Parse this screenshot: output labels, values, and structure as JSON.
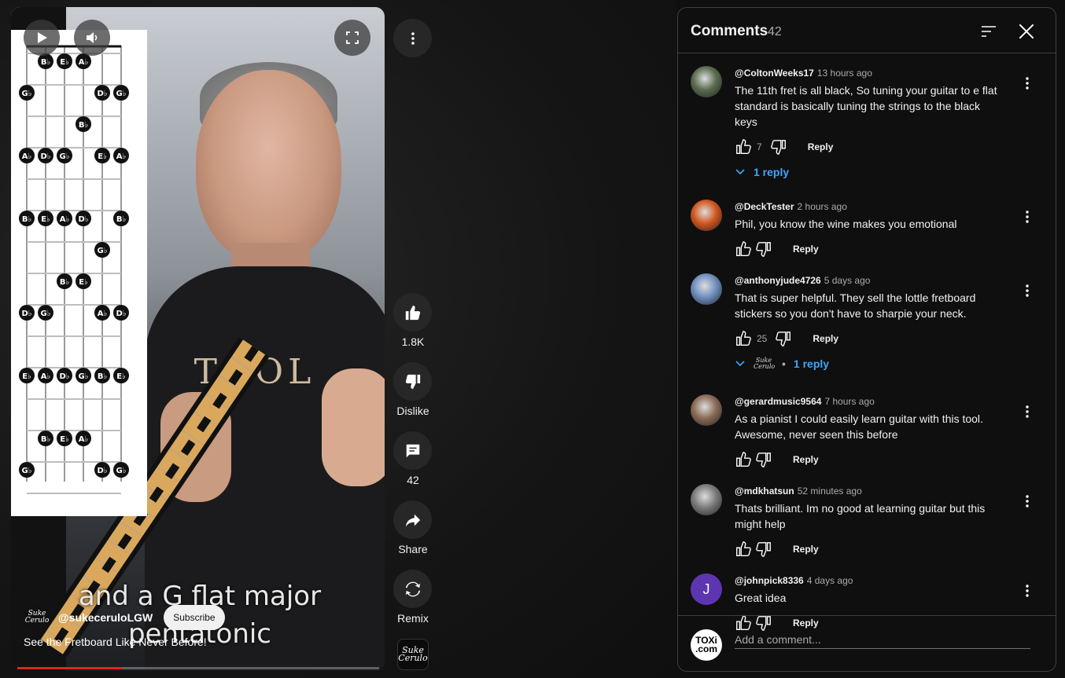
{
  "colors": {
    "bg": "#0f0f0f",
    "panel_border": "#3f3f3f",
    "link_blue": "#3ea6ff",
    "progress_red": "#e02424",
    "avatar_purple": "#5e35b1"
  },
  "video": {
    "subtitle_line1": "and a G flat major",
    "subtitle_line2": "pentatonic",
    "shirt_logo": "TOOL",
    "channel_logo_text": "Suke Cerulo",
    "channel_name": "@sukeceruloLGW",
    "subscribe_label": "Subscribe",
    "title": "See the Fretboard Like Never Before!",
    "progress_fraction": 0.29,
    "controls": {
      "play_icon": "play-icon",
      "volume_icon": "volume-icon",
      "fullscreen_icon": "fullscreen-icon"
    }
  },
  "fretboard_notes": {
    "rows": [
      [
        "",
        "B♭",
        "E♭",
        "A♭",
        "",
        ""
      ],
      [
        "G♭",
        "",
        "",
        "",
        "D♭",
        "G♭"
      ],
      [
        "",
        "",
        "",
        "B♭",
        "",
        ""
      ],
      [
        "A♭",
        "D♭",
        "G♭",
        "",
        "E♭",
        "A♭"
      ],
      [
        "",
        "",
        "",
        "",
        "",
        ""
      ],
      [
        "B♭",
        "E♭",
        "A♭",
        "D♭",
        "",
        "B♭"
      ],
      [
        "",
        "",
        "",
        "",
        "G♭",
        ""
      ],
      [
        "",
        "",
        "B♭",
        "E♭",
        "",
        ""
      ],
      [
        "D♭",
        "G♭",
        "",
        "",
        "A♭",
        "D♭"
      ],
      [
        "",
        "",
        "",
        "",
        "",
        ""
      ],
      [
        "E♭",
        "A♭",
        "D♭",
        "G♭",
        "B♭",
        "E♭"
      ],
      [
        "",
        "",
        "",
        "",
        "",
        ""
      ],
      [
        "",
        "B♭",
        "E♭",
        "A♭",
        "",
        ""
      ],
      [
        "G♭",
        "",
        "",
        "",
        "D♭",
        "G♭"
      ]
    ]
  },
  "rail": {
    "more_icon": "more-vert-icon",
    "like_count": "1.8K",
    "dislike_label": "Dislike",
    "comment_count": "42",
    "share_label": "Share",
    "remix_label": "Remix",
    "channel_thumb_text": "Suke Cerulo"
  },
  "comments_panel": {
    "title": "Comments",
    "count": "42",
    "add_placeholder": "Add a comment...",
    "user_avatar_line1": "TOXi",
    "user_avatar_line2": ".com",
    "reply_label": "Reply",
    "comments": [
      {
        "author": "@ColtonWeeks17",
        "time": "13 hours ago",
        "text": "The 11th fret is all black, So tuning your guitar to e flat standard is basically tuning the strings to the black keys",
        "likes": "7",
        "replies": "1 reply",
        "avatar_color": "#5a6b4e"
      },
      {
        "author": "@DeckTester",
        "time": "2 hours ago",
        "text": "Phil, you know the wine makes you emotional",
        "likes": "",
        "avatar_color": "#d2561e"
      },
      {
        "author": "@anthonyjude4726",
        "time": "5 days ago",
        "text": "That is super helpful. They sell the lottle fretboard stickers so you don't have to sharpie your neck.",
        "likes": "25",
        "replies": "1 reply",
        "replies_creator": "Suke Cerulo",
        "avatar_color": "#6f8fbf"
      },
      {
        "author": "@gerardmusic9564",
        "time": "7 hours ago",
        "text": "As a pianist I could easily learn guitar with this tool. Awesome, never seen this before",
        "likes": "",
        "avatar_color": "#8a6a55"
      },
      {
        "author": "@mdkhatsun",
        "time": "52 minutes ago",
        "text": "Thats brilliant. Im no good at learning guitar but this might help",
        "likes": "",
        "avatar_color": "#7a7a7a"
      },
      {
        "author": "@johnpick8336",
        "time": "4 days ago",
        "text": "Great idea",
        "likes": "",
        "avatar_letter": "J",
        "avatar_color": "#5e35b1"
      }
    ]
  }
}
